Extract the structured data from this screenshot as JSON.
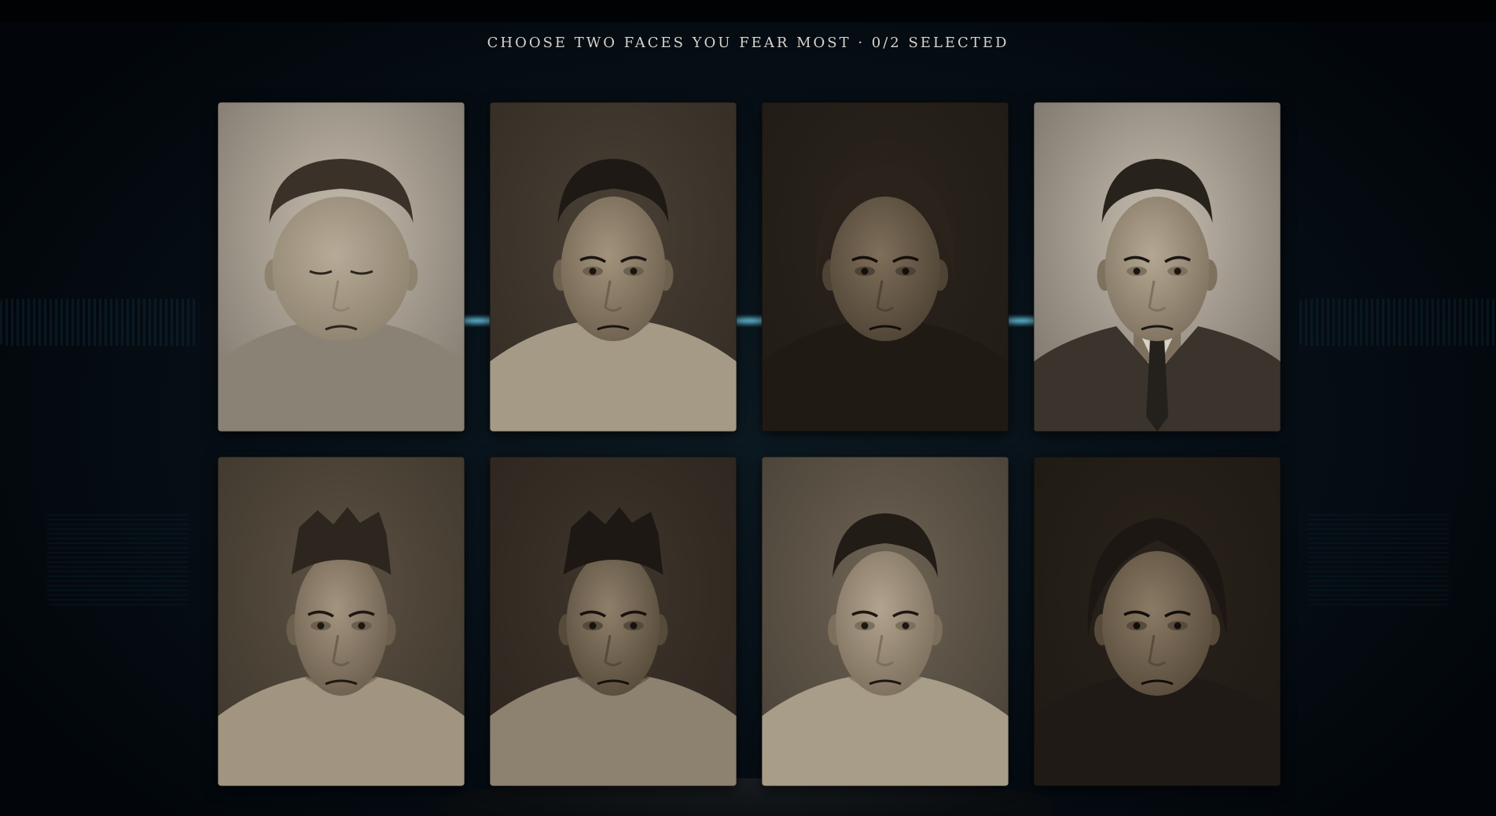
{
  "prompt": {
    "text": "CHOOSE TWO FACES YOU FEAR MOST · 0/2 SELECTED"
  },
  "colors": {
    "background": "#03070b",
    "accent_glow": "#6ecff0",
    "prompt_text": "#d8d4cc"
  },
  "faces": [
    {
      "id": "heavy-man",
      "style": {
        "bg": "#c8bfb1",
        "skin": "#b7ab98",
        "shade": "#8e836f",
        "hair": "#3a3128",
        "shirt": "#8a8275",
        "dark": "#2b241d",
        "fat": 1.25,
        "suit": false,
        "hairLen": "short",
        "eyesClosed": true
      }
    },
    {
      "id": "young-worried-man",
      "style": {
        "bg": "#4a4136",
        "skin": "#a2937c",
        "shade": "#6d604e",
        "hair": "#1e1914",
        "shirt": "#a59a85",
        "dark": "#1a1510",
        "fat": 0.95,
        "suit": false,
        "hairLen": "short",
        "eyesClosed": false
      }
    },
    {
      "id": "old-woman",
      "style": {
        "bg": "#2c251e",
        "skin": "#7e6e5a",
        "shade": "#4e4334",
        "hair": "#2a221b",
        "shirt": "#201a15",
        "dark": "#140f0b",
        "fat": 1.0,
        "suit": false,
        "hairLen": "long",
        "eyesClosed": false
      }
    },
    {
      "id": "stern-suit-man",
      "style": {
        "bg": "#c9c0b2",
        "skin": "#b5a893",
        "shade": "#7e725f",
        "hair": "#28221c",
        "shirt": "#3a342d",
        "dark": "#1a1612",
        "fat": 0.95,
        "suit": true,
        "hairLen": "short",
        "eyesClosed": false
      }
    },
    {
      "id": "gaunt-man",
      "style": {
        "bg": "#5c5244",
        "skin": "#a39480",
        "shade": "#6c5f4d",
        "hair": "#2d261e",
        "shirt": "#a19581",
        "dark": "#1e1812",
        "fat": 0.85,
        "suit": false,
        "hairLen": "messy",
        "eyesClosed": false
      }
    },
    {
      "id": "tired-man",
      "style": {
        "bg": "#3f362c",
        "skin": "#8e7f6a",
        "shade": "#564a3a",
        "hair": "#1d1813",
        "shirt": "#8d8170",
        "dark": "#17120e",
        "fat": 0.85,
        "suit": false,
        "hairLen": "messy",
        "eyesClosed": false
      }
    },
    {
      "id": "pale-man",
      "style": {
        "bg": "#6f6556",
        "skin": "#b1a38e",
        "shade": "#7c6f5c",
        "hair": "#221c16",
        "shirt": "#a89d88",
        "dark": "#1c1712",
        "fat": 0.9,
        "suit": false,
        "hairLen": "short",
        "eyesClosed": false
      }
    },
    {
      "id": "sad-woman",
      "style": {
        "bg": "#2a231c",
        "skin": "#8a7a65",
        "shade": "#584b3b",
        "hair": "#1c1712",
        "shirt": "#1f1a15",
        "dark": "#120e0a",
        "fat": 1.0,
        "suit": false,
        "hairLen": "long",
        "eyesClosed": false
      }
    }
  ]
}
